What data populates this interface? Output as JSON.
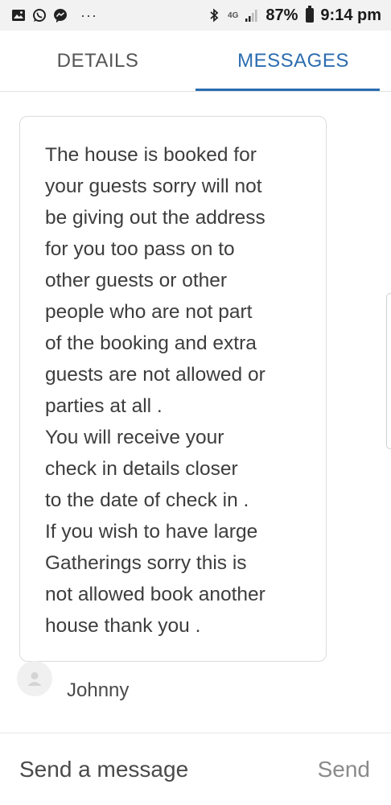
{
  "status_bar": {
    "icons": [
      "gallery-icon",
      "whatsapp-icon",
      "messenger-icon",
      "more-dots-icon",
      "bluetooth-icon",
      "network-4g-icon",
      "signal-icon",
      "battery-icon"
    ],
    "more": "···",
    "network": "4G",
    "battery_percent": "87%",
    "time": "9:14 pm"
  },
  "tabs": [
    {
      "label": "DETAILS",
      "active": false
    },
    {
      "label": "MESSAGES",
      "active": true
    }
  ],
  "colors": {
    "accent": "#2b6cb0",
    "text": "#3d3d3d",
    "muted": "#8a8a8a"
  },
  "message": {
    "text": "The house is booked for\nyour guests sorry will not\nbe giving out the address\nfor you too pass on to\nother guests or other\npeople who are not part\nof the booking and extra\nguests are not allowed or\nparties at all .\nYou will receive your\ncheck in details closer\nto the date of check in .\nIf you wish to have large\nGatherings sorry this is\nnot allowed book another\nhouse thank you .",
    "sender": "Johnny",
    "avatar_icon": "user-avatar-icon"
  },
  "composer": {
    "placeholder": "Send a message",
    "value": "",
    "send_label": "Send"
  }
}
